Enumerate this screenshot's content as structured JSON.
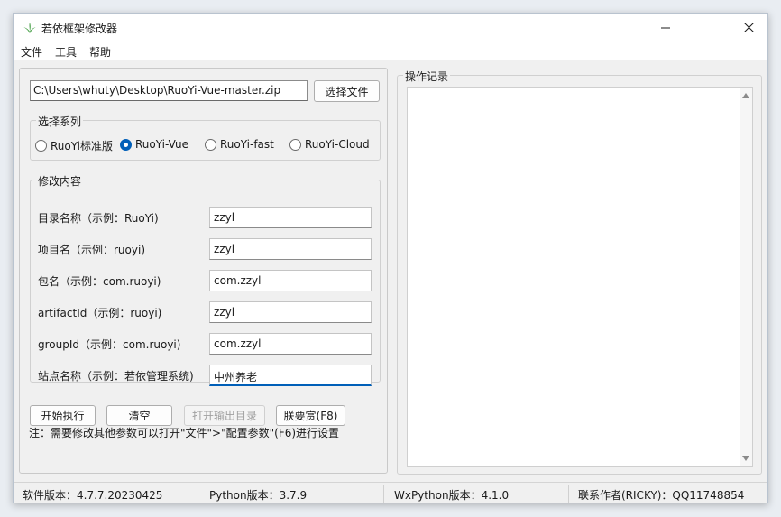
{
  "window": {
    "title": "若依框架修改器"
  },
  "menu": [
    "文件",
    "工具",
    "帮助"
  ],
  "file": {
    "path": "C:\\Users\\whuty\\Desktop\\RuoYi-Vue-master.zip",
    "choose_label": "选择文件"
  },
  "series": {
    "title": "选择系列",
    "options": [
      {
        "label": "RuoYi标准版",
        "checked": false
      },
      {
        "label": "RuoYi-Vue",
        "checked": true
      },
      {
        "label": "RuoYi-fast",
        "checked": false
      },
      {
        "label": "RuoYi-Cloud",
        "checked": false
      }
    ]
  },
  "modify": {
    "title": "修改内容",
    "fields": [
      {
        "label": "目录名称（示例：RuoYi)",
        "value": "zzyl"
      },
      {
        "label": "项目名（示例：ruoyi)",
        "value": "zzyl"
      },
      {
        "label": "包名（示例：com.ruoyi)",
        "value": "com.zzyl"
      },
      {
        "label": "artifactId（示例：ruoyi)",
        "value": "zzyl"
      },
      {
        "label": "groupId（示例：com.ruoyi)",
        "value": "com.zzyl"
      },
      {
        "label": "站点名称（示例：若依管理系统)",
        "value": "中州养老"
      }
    ]
  },
  "actions": {
    "start": "开始执行",
    "clear": "清空",
    "open_output": "打开输出目录",
    "donate": "朕要赏(F8)"
  },
  "note": "注：需要修改其他参数可以打开\"文件\">\"配置参数\"(F6)进行设置",
  "log": {
    "title": "操作记录"
  },
  "status": {
    "software": "软件版本：4.7.7.20230425",
    "python": "Python版本：3.7.9",
    "wxpython": "WxPython版本：4.1.0",
    "author": "联系作者(RICKY)：QQ11748854"
  }
}
